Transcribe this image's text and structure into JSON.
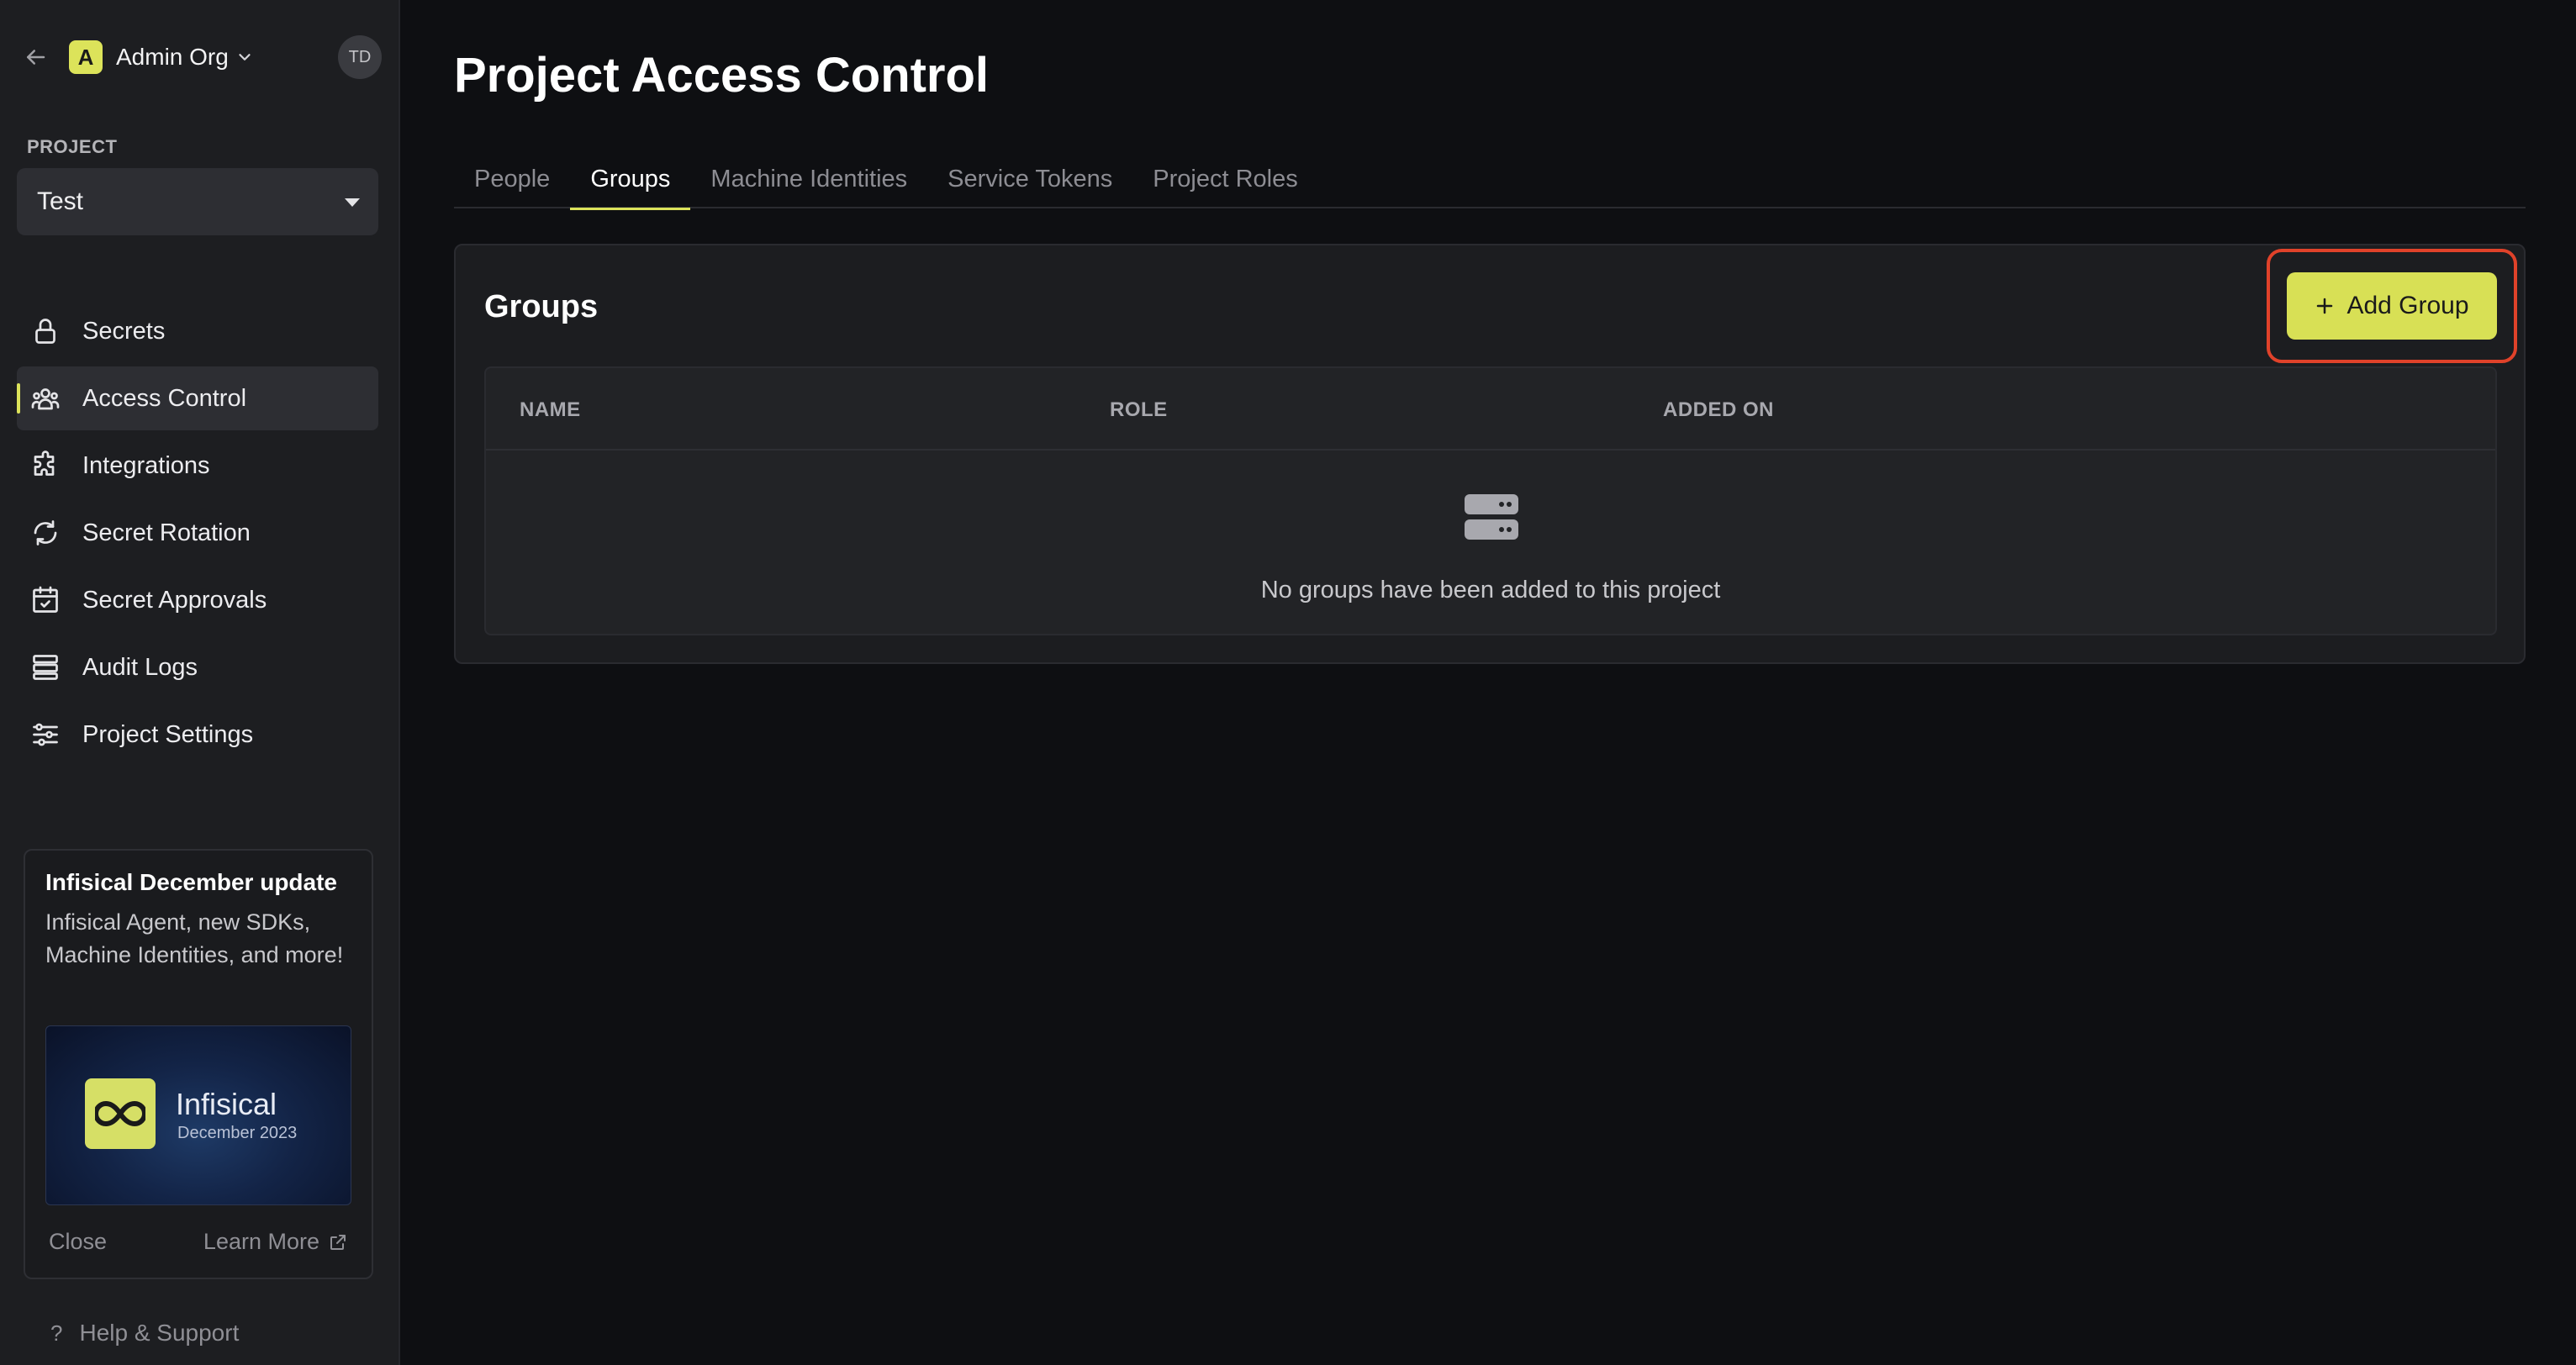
{
  "org": {
    "name": "Admin Org",
    "logo_letter": "A",
    "avatar": "TD"
  },
  "project": {
    "label": "PROJECT",
    "selected": "Test"
  },
  "sidebar": {
    "items": [
      {
        "label": "Secrets",
        "icon": "lock-icon"
      },
      {
        "label": "Access Control",
        "icon": "users-icon",
        "active": true
      },
      {
        "label": "Integrations",
        "icon": "puzzle-icon"
      },
      {
        "label": "Secret Rotation",
        "icon": "rotate-icon"
      },
      {
        "label": "Secret Approvals",
        "icon": "calendar-check-icon"
      },
      {
        "label": "Audit Logs",
        "icon": "list-icon"
      },
      {
        "label": "Project Settings",
        "icon": "sliders-icon"
      }
    ]
  },
  "update_card": {
    "title": "Infisical December update",
    "body": "Infisical Agent, new SDKs, Machine Identities, and more!",
    "brand_name": "Infisical",
    "brand_date": "December 2023",
    "close_label": "Close",
    "learn_more_label": "Learn More"
  },
  "help": {
    "label": "Help & Support"
  },
  "page": {
    "title": "Project Access Control"
  },
  "tabs": [
    {
      "label": "People"
    },
    {
      "label": "Groups",
      "active": true
    },
    {
      "label": "Machine Identities"
    },
    {
      "label": "Service Tokens"
    },
    {
      "label": "Project Roles"
    }
  ],
  "groups_panel": {
    "title": "Groups",
    "add_button_label": "Add Group",
    "columns": [
      "NAME",
      "ROLE",
      "ADDED ON"
    ],
    "empty_message": "No groups have been added to this project"
  },
  "colors": {
    "accent": "#dce35a",
    "highlight": "#e0422a",
    "sidebar_bg": "#1d1e21",
    "main_bg": "#0e0f12"
  }
}
